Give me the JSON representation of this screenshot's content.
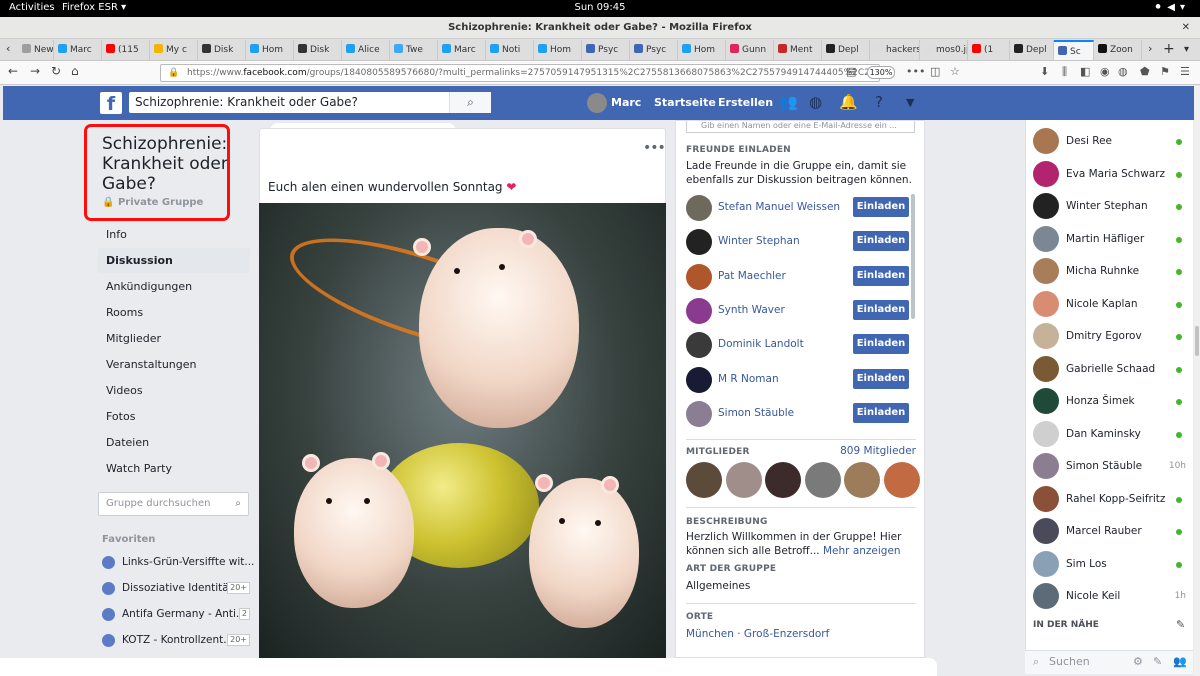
{
  "system": {
    "activities": "Activities",
    "app": "Firefox ESR",
    "clock": "Sun 09:45"
  },
  "window": {
    "title": "Schizophrenie: Krankheit oder Gabe? - Mozilla Firefox"
  },
  "tabs": [
    {
      "label": "New",
      "color": "#9e9e9e"
    },
    {
      "label": "Marc",
      "color": "#1da1f2"
    },
    {
      "label": "(115",
      "color": "#ff0000"
    },
    {
      "label": "My c",
      "color": "#f4b400"
    },
    {
      "label": "Disk",
      "color": "#333333"
    },
    {
      "label": "Hom",
      "color": "#1da1f2"
    },
    {
      "label": "Disk",
      "color": "#333333"
    },
    {
      "label": "Alice",
      "color": "#1da1f2"
    },
    {
      "label": "Twe",
      "color": "#3fa9f5"
    },
    {
      "label": "Marc",
      "color": "#1da1f2"
    },
    {
      "label": "Noti",
      "color": "#1da1f2"
    },
    {
      "label": "Hom",
      "color": "#1da1f2"
    },
    {
      "label": "Psyc",
      "color": "#4267b2"
    },
    {
      "label": "Psyc",
      "color": "#4267b2"
    },
    {
      "label": "Hom",
      "color": "#1da1f2"
    },
    {
      "label": "Gunn",
      "color": "#e0245e"
    },
    {
      "label": "Ment",
      "color": "#c62828"
    },
    {
      "label": "Depl",
      "color": "#222222"
    },
    {
      "label": "hackers",
      "color": "#dddddd"
    },
    {
      "label": "mos0.jp",
      "color": "#dddddd"
    },
    {
      "label": "(1",
      "color": "#ff0000"
    },
    {
      "label": "Depl",
      "color": "#222222"
    },
    {
      "label": "Sc",
      "color": "#4267b2"
    },
    {
      "label": "Zoon",
      "color": "#111111"
    }
  ],
  "nav": {
    "url_prefix": "https://www.",
    "url_host": "facebook.com",
    "url_rest": "/groups/1840805589576680/?multi_permalinks=2757059147951315%2C2755813668075863%2C2755794914744405%2C2",
    "zoom": "130%"
  },
  "fb": {
    "search_value": "Schizophrenie: Krankheit oder Gabe?",
    "user": "Marc",
    "home": "Startseite",
    "create": "Erstellen"
  },
  "group": {
    "title": "Schizophrenie: Krankheit oder Gabe?",
    "privacy": "Private Gruppe",
    "nav": [
      "Info",
      "Diskussion",
      "Ankündigungen",
      "Rooms",
      "Mitglieder",
      "Veranstaltungen",
      "Videos",
      "Fotos",
      "Dateien",
      "Watch Party"
    ],
    "selected_nav": "Diskussion",
    "search_placeholder": "Gruppe durchsuchen",
    "favorites_heading": "Favoriten",
    "favorites": [
      {
        "label": "Links-Grün-Versiffte wit...",
        "count": ""
      },
      {
        "label": "Dissoziative Identitä...",
        "count": "20+"
      },
      {
        "label": "Antifa Germany - Anti...",
        "count": "2"
      },
      {
        "label": "KOTZ - Kontrollzent...",
        "count": "20+"
      }
    ]
  },
  "post": {
    "text": "Euch alen einen wundervollen Sonntag",
    "more": "•••"
  },
  "sidebar": {
    "search_placeholder": "Gib einen Namen oder eine E-Mail-Adresse ein ...",
    "invite_heading": "FREUNDE EINLADEN",
    "invite_text": "Lade Freunde in die Gruppe ein, damit sie ebenfalls zur Diskussion beitragen können.",
    "invite_button": "Einladen",
    "invitees": [
      {
        "name": "Stefan Manuel Weissen",
        "color": "#6d6a5b"
      },
      {
        "name": "Winter Stephan",
        "color": "#222222"
      },
      {
        "name": "Pat Maechler",
        "color": "#b0562b"
      },
      {
        "name": "Synth Waver",
        "color": "#8a3b8f"
      },
      {
        "name": "Dominik Landolt",
        "color": "#3a3a3a"
      },
      {
        "name": "M R Noman",
        "color": "#191b35"
      },
      {
        "name": "Simon Stäuble",
        "color": "#8b7d92"
      }
    ],
    "members_heading": "MITGLIEDER",
    "members_count": "809 Mitglieder",
    "member_colors": [
      "#5c4a3a",
      "#a08e8a",
      "#3d2b2b",
      "#7a7a7a",
      "#9c7c5a",
      "#c26a42"
    ],
    "desc_heading": "BESCHREIBUNG",
    "desc_text": "Herzlich Willkommen in der Gruppe! Hier können sich alle Betroff...",
    "desc_more": "Mehr anzeigen",
    "type_heading": "ART DER GRUPPE",
    "type_value": "Allgemeines",
    "places_heading": "ORTE",
    "places_value": "München · Groß-Enzersdorf"
  },
  "chat": {
    "contacts": [
      {
        "name": "Desi Ree",
        "time": "",
        "color": "#a87752"
      },
      {
        "name": "Eva Maria Schwarz",
        "time": "",
        "color": "#b2246e"
      },
      {
        "name": "Winter Stephan",
        "time": "",
        "color": "#222222"
      },
      {
        "name": "Martin Häfliger",
        "time": "",
        "color": "#7c8794"
      },
      {
        "name": "Micha Ruhnke",
        "time": "",
        "color": "#a77d5a"
      },
      {
        "name": "Nicole Kaplan",
        "time": "",
        "color": "#d88d73"
      },
      {
        "name": "Dmitry Egorov",
        "time": "",
        "color": "#c5b299"
      },
      {
        "name": "Gabrielle Schaad",
        "time": "",
        "color": "#7a5a34"
      },
      {
        "name": "Honza Šimek",
        "time": "",
        "color": "#1f4a3a"
      },
      {
        "name": "Dan Kaminsky",
        "time": "",
        "color": "#cfcfcf"
      },
      {
        "name": "Simon Stäuble",
        "time": "10h",
        "color": "#8b7d92"
      },
      {
        "name": "Rahel Kopp-Seifritz",
        "time": "",
        "color": "#8a5038"
      },
      {
        "name": "Marcel Rauber",
        "time": "",
        "color": "#4a4a5a"
      },
      {
        "name": "Sim Los",
        "time": "",
        "color": "#8aa0b4"
      },
      {
        "name": "Nicole Keil",
        "time": "1h",
        "color": "#5d6a78"
      }
    ],
    "nearby_heading": "IN DER NÄHE",
    "search_placeholder": "Suchen"
  }
}
